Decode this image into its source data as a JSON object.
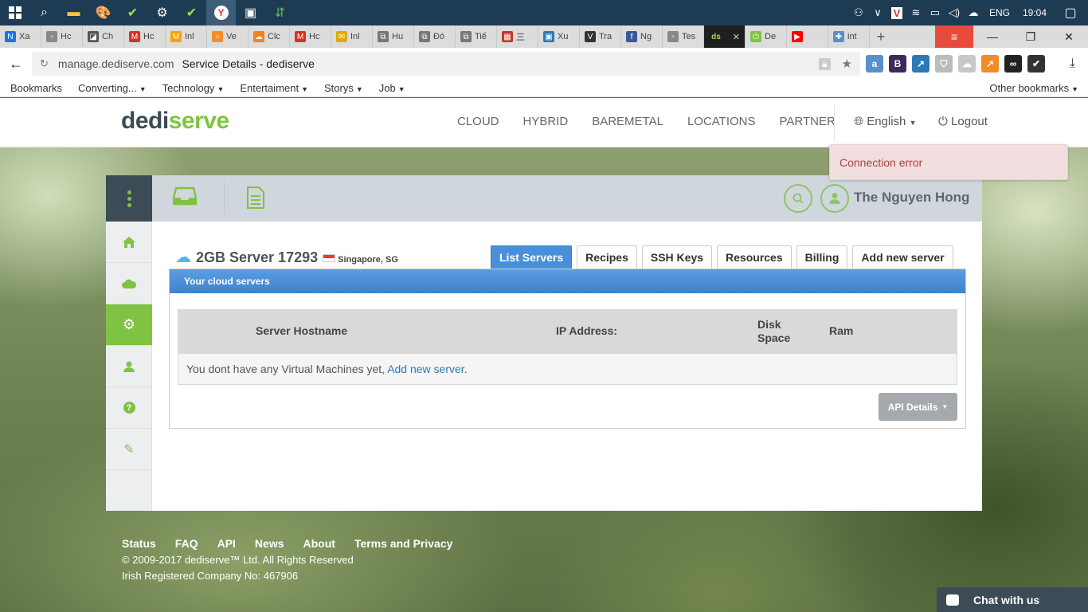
{
  "taskbar": {
    "lang": "ENG",
    "time": "19:04"
  },
  "browser_tabs": [
    {
      "label": "Xa",
      "fav_color": "#1a73e8",
      "fav": "N"
    },
    {
      "label": "Hc",
      "fav_color": "#888888",
      "fav": "▫"
    },
    {
      "label": "Ch",
      "fav_color": "#555555",
      "fav": "◪"
    },
    {
      "label": "Hc",
      "fav_color": "#d93025",
      "fav": "M"
    },
    {
      "label": "Inl",
      "fav_color": "#f6a400",
      "fav": "M"
    },
    {
      "label": "Ve",
      "fav_color": "#f28c28",
      "fav": "○"
    },
    {
      "label": "Clc",
      "fav_color": "#f48120",
      "fav": "☁"
    },
    {
      "label": "Hc",
      "fav_color": "#d93025",
      "fav": "M"
    },
    {
      "label": "Inl",
      "fav_color": "#e0a800",
      "fav": "✉"
    },
    {
      "label": "Hu",
      "fav_color": "#777777",
      "fav": "⧉"
    },
    {
      "label": "Đó",
      "fav_color": "#777777",
      "fav": "⧉"
    },
    {
      "label": "Tiế",
      "fav_color": "#777777",
      "fav": "⧉"
    },
    {
      "label": "三",
      "fav_color": "#c0392b",
      "fav": "▦"
    },
    {
      "label": "Xu",
      "fav_color": "#2a7ab8",
      "fav": "▣"
    },
    {
      "label": "Tra",
      "fav_color": "#333333",
      "fav": "V"
    },
    {
      "label": "Ng",
      "fav_color": "#3b5998",
      "fav": "f"
    },
    {
      "label": "Tes",
      "fav_color": "#888888",
      "fav": "▫"
    },
    {
      "label": "",
      "fav_color": "#1f1f1f",
      "fav": "ds",
      "active": true
    },
    {
      "label": "De",
      "fav_color": "#80c342",
      "fav": "⏻"
    },
    {
      "label": "",
      "fav_color": "#ff0000",
      "fav": "▶"
    },
    {
      "label": "int",
      "fav_color": "#5b8fc7",
      "fav": "✚"
    }
  ],
  "address": {
    "domain": "manage.dediserve.com",
    "page_title": "Service Details - dediserve"
  },
  "bookmarks": {
    "items": [
      "Bookmarks",
      "Converting...",
      "Technology",
      "Entertaiment",
      "Storys",
      "Job"
    ],
    "other": "Other bookmarks"
  },
  "site": {
    "logo_part1": "dedi",
    "logo_part2": "serve",
    "nav": [
      "CLOUD",
      "HYBRID",
      "BAREMETAL",
      "LOCATIONS",
      "PARTNER"
    ],
    "language": "English",
    "logout": "Logout"
  },
  "toast": {
    "message": "Connection error"
  },
  "user": {
    "name": "The Nguyen Hong"
  },
  "server": {
    "name": "2GB Server 17293",
    "location": "Singapore, SG"
  },
  "tabs": [
    "List Servers",
    "Recipes",
    "SSH Keys",
    "Resources",
    "Billing",
    "Add new server"
  ],
  "servers_box": {
    "title": "Your cloud servers",
    "columns": {
      "hostname": "Server Hostname",
      "ip": "IP Address:",
      "disk_line1": "Disk",
      "disk_line2": "Space",
      "ram": "Ram"
    },
    "empty_text": "You dont have any Virtual Machines yet,",
    "empty_link": "Add new server",
    "empty_dot": ".",
    "api_button": "API Details"
  },
  "footer": {
    "links": [
      "Status",
      "FAQ",
      "API",
      "News",
      "About",
      "Terms and Privacy"
    ],
    "copyright": "© 2009-2017 dediserve™ Ltd. All Rights Reserved",
    "company": "Irish Registered Company No: 467906"
  },
  "chat": {
    "label": "Chat with us"
  },
  "colors": {
    "brand_green": "#80c342",
    "brand_dark": "#3c4b55",
    "tab_active": "#4a8fd9",
    "error_bg": "#f2dede"
  }
}
